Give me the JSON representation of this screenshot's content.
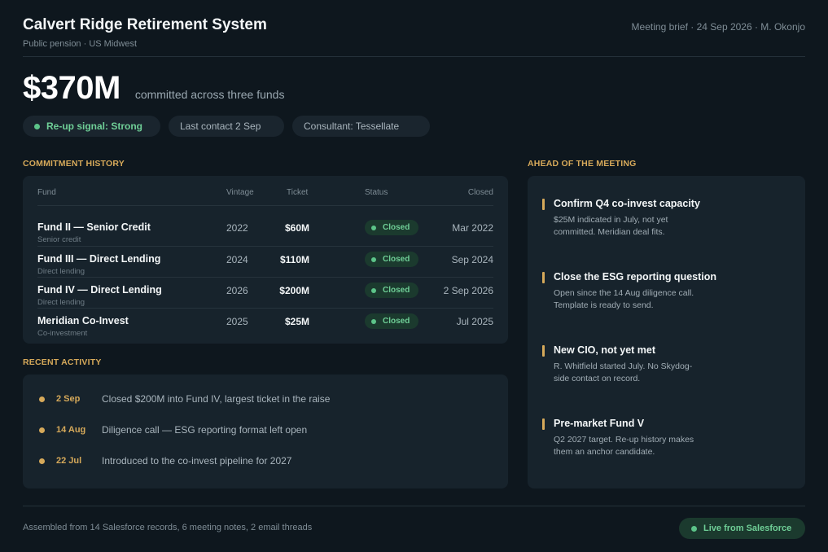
{
  "header": {
    "title": "Calvert Ridge Retirement System",
    "subtitle": "Public pension · US Midwest",
    "meta": "Meeting brief · 24 Sep 2026 · M. Okonjo"
  },
  "hero": {
    "amount": "$370M",
    "caption": "committed across three funds"
  },
  "pills": {
    "signal": "Re-up signal: Strong",
    "last_contact": "Last contact 2 Sep",
    "consultant": "Consultant: Tessellate"
  },
  "commitment_history": {
    "label": "COMMITMENT HISTORY",
    "columns": {
      "fund": "Fund",
      "vintage": "Vintage",
      "ticket": "Ticket",
      "status": "Status",
      "closed": "Closed"
    },
    "rows": [
      {
        "name": "Fund II — Senior Credit",
        "type": "Senior credit",
        "vintage": "2022",
        "ticket": "$60M",
        "status": "Closed",
        "closed": "Mar 2022"
      },
      {
        "name": "Fund III — Direct Lending",
        "type": "Direct lending",
        "vintage": "2024",
        "ticket": "$110M",
        "status": "Closed",
        "closed": "Sep 2024"
      },
      {
        "name": "Fund IV — Direct Lending",
        "type": "Direct lending",
        "vintage": "2026",
        "ticket": "$200M",
        "status": "Closed",
        "closed": "2 Sep 2026"
      },
      {
        "name": "Meridian Co-Invest",
        "type": "Co-investment",
        "vintage": "2025",
        "ticket": "$25M",
        "status": "Closed",
        "closed": "Jul 2025"
      }
    ]
  },
  "recent_activity": {
    "label": "RECENT ACTIVITY",
    "items": [
      {
        "date": "2 Sep",
        "text": "Closed $200M into Fund IV, largest ticket in the raise"
      },
      {
        "date": "14 Aug",
        "text": "Diligence call — ESG reporting format left open"
      },
      {
        "date": "22 Jul",
        "text": "Introduced to the co-invest pipeline for 2027"
      }
    ]
  },
  "ahead": {
    "label": "AHEAD OF THE MEETING",
    "items": [
      {
        "title": "Confirm Q4 co-invest capacity",
        "body": "$25M indicated in July, not yet committed. Meridian deal fits."
      },
      {
        "title": "Close the ESG reporting question",
        "body": "Open since the 14 Aug diligence call. Template is ready to send."
      },
      {
        "title": "New CIO, not yet met",
        "body": "R. Whitfield started July. No Skydog-side contact on record."
      },
      {
        "title": "Pre-market Fund V",
        "body": "Q2 2027 target. Re-up history makes them an anchor candidate."
      }
    ]
  },
  "footer": {
    "sources": "Assembled from 14 Salesforce records, 6 meeting notes, 2 email threads",
    "live": "Live from Salesforce"
  },
  "colors": {
    "background": "#0e171e",
    "card": "#17232c",
    "accent_gold": "#d6a95a",
    "status_green": "#6fcf97"
  }
}
